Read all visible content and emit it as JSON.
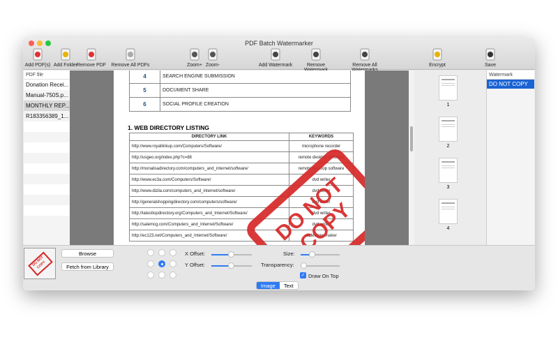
{
  "window": {
    "title": "PDF Batch Watermarker"
  },
  "toolbar": [
    {
      "label": "Add PDF(s)",
      "icon": "add-pdf-icon"
    },
    {
      "label": "Add Folder",
      "icon": "add-folder-icon"
    },
    {
      "label": "Remove PDF",
      "icon": "remove-pdf-icon"
    },
    {
      "label": "Remove All PDFs",
      "icon": "remove-all-pdfs-icon"
    },
    {
      "label": "Zoom+",
      "icon": "zoom-in-icon"
    },
    {
      "label": "Zoom-",
      "icon": "zoom-out-icon"
    },
    {
      "label": "Add Watermark",
      "icon": "add-watermark-icon"
    },
    {
      "label": "Remove Watermark",
      "icon": "remove-watermark-icon"
    },
    {
      "label": "Remove All Watermarks",
      "icon": "remove-all-watermarks-icon"
    },
    {
      "label": "Encrypt",
      "icon": "lock-icon"
    },
    {
      "label": "Save",
      "icon": "floppy-icon"
    }
  ],
  "pdf_list": {
    "header": "PDF file",
    "items": [
      "Donation Recei...",
      "Manual-750S.p...",
      "MONTHLY REP...",
      "R183356389_1..."
    ],
    "selected": 2
  },
  "document": {
    "toc": [
      {
        "n": "4",
        "t": "SEARCH ENGINE SUBMISSION"
      },
      {
        "n": "5",
        "t": "DOCUMENT SHARE"
      },
      {
        "n": "6",
        "t": "SOCIAL PROFILE CREATION"
      }
    ],
    "heading": "1.  WEB DIRECTORY LISTING",
    "columns": [
      "DIRECTORY LINK",
      "KEYWORDS"
    ],
    "rows": [
      [
        "http://www.royallinkup.com/Computers/Software/",
        "microphone recorder"
      ],
      [
        "http://usgeo.org/index.php?c=88",
        "remote desktop software"
      ],
      [
        "http://monalisadirectory.com/computers_and_internet/software/",
        "remote desktop software"
      ],
      [
        "http://www.ec3a.com/Computers/Software/",
        "dvd writer"
      ],
      [
        "http://www.dizila.com/computers_and_internet/software/",
        "dvd writer"
      ],
      [
        "http://generalshoppingdirectory.com/computers/software/",
        "dvd writer"
      ],
      [
        "http://latesttopdirectory.org/Computers_and_Internet/Software/",
        "dvd writer"
      ],
      [
        "http://salemcg.com/Computers_and_Internet/Software/",
        "dvd writer"
      ],
      [
        "http://ec123.net/Computers_and_Internet/Software/",
        "slideshow maker"
      ]
    ],
    "stamp_text": "DO NOT COPY"
  },
  "thumbnails": [
    "1",
    "2",
    "3",
    "4"
  ],
  "watermark_list": {
    "header": "Watermark",
    "items": [
      "DO NOT COPY"
    ]
  },
  "bottom": {
    "browse": "Browse",
    "fetch": "Fetch from Library",
    "position_selected": "center",
    "x_offset_label": "X Offset:",
    "x_offset": 0.5,
    "y_offset_label": "Y Offset:",
    "y_offset": 0.5,
    "size_label": "Size:",
    "size": 0.3,
    "transparency_label": "Transparency:",
    "transparency": 0,
    "draw_on_top_label": "Draw On Top",
    "draw_on_top": true,
    "tabs": [
      "Image",
      "Text"
    ],
    "active_tab": "Image"
  },
  "colors": {
    "accent": "#2f7bf5",
    "stamp": "#d62828",
    "selection": "#1a63d3"
  }
}
